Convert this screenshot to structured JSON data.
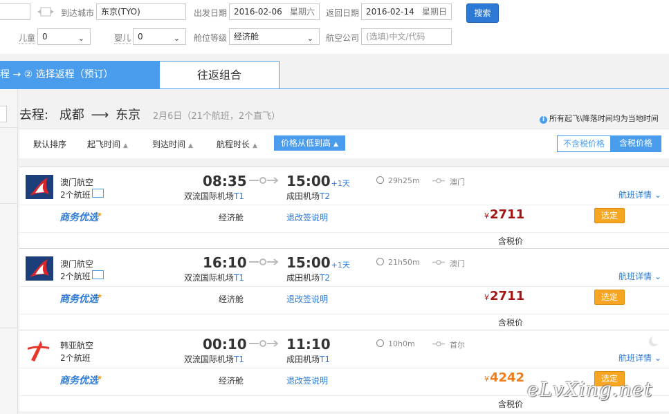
{
  "search": {
    "arrive_city_label": "到达城市",
    "arrive_city_value": "东京(TYO)",
    "depart_date_label": "出发日期",
    "depart_date_value": "2016-02-06",
    "depart_weekday": "星期六",
    "return_date_label": "返回日期",
    "return_date_value": "2016-02-14",
    "return_weekday": "星期日",
    "search_button": "搜索",
    "child_label": "儿童",
    "child_value": "0",
    "infant_label": "婴儿",
    "infant_value": "0",
    "cabin_label": "舱位等级",
    "cabin_value": "经济舱",
    "airline_label": "航空公司",
    "airline_placeholder": "(选填)中文/代码",
    "swap_icon": "swap-icon"
  },
  "steps": {
    "step_text": "程 → ② 选择返程（预订）",
    "combo_tab": "往返组合"
  },
  "route": {
    "prefix": "去程:",
    "from": "成都",
    "to": "东京",
    "summary": "2月6日（21个航班，2个直飞）",
    "local_time_note": "所有起飞\\降落时间均为当地时间"
  },
  "sort": {
    "default": "默认排序",
    "depart_time": "起飞时间",
    "arrive_time": "到达时间",
    "duration": "航程时长",
    "price_low_high": "价格从低到高",
    "excl_tax": "不含税价格",
    "incl_tax": "含税价格"
  },
  "flights": [
    {
      "airline": "澳门航空",
      "flight_count": "2个航班",
      "logo": "air-macau-logo",
      "dep_time": "08:35",
      "dep_airport": "双流国际机场",
      "dep_terminal": "T1",
      "arr_time": "15:00",
      "arr_plus": "+1天",
      "arr_airport": "成田机场",
      "arr_terminal": "T2",
      "duration": "29h25m",
      "stop_city": "澳门",
      "detail": "航班详情",
      "biz_label": "商务优选",
      "cabin": "经济舱",
      "rules": "退改签说明",
      "currency": "¥",
      "price": "2711",
      "price_color": "#a31515",
      "choose": "选定",
      "tax_note": "含税价"
    },
    {
      "airline": "澳门航空",
      "flight_count": "2个航班",
      "logo": "air-macau-logo",
      "dep_time": "16:10",
      "dep_airport": "双流国际机场",
      "dep_terminal": "T1",
      "arr_time": "15:00",
      "arr_plus": "+1天",
      "arr_airport": "成田机场",
      "arr_terminal": "T2",
      "duration": "21h50m",
      "stop_city": "澳门",
      "detail": "航班详情",
      "biz_label": "商务优选",
      "cabin": "经济舱",
      "rules": "退改签说明",
      "currency": "¥",
      "price": "2711",
      "price_color": "#a31515",
      "choose": "选定",
      "tax_note": "含税价"
    },
    {
      "airline": "韩亚航空",
      "flight_count": "2个航班",
      "logo": "asiana-logo",
      "dep_time": "00:10",
      "dep_airport": "双流国际机场",
      "dep_terminal": "T1",
      "arr_time": "11:10",
      "arr_plus": "",
      "arr_airport": "成田机场",
      "arr_terminal": "T1",
      "duration": "10h0m",
      "stop_city": "首尔",
      "detail": "航班详情",
      "biz_label": "商务优选",
      "cabin": "经济舱",
      "rules": "退改签说明",
      "currency": "¥",
      "price": "4242",
      "price_color": "#f07c1a",
      "choose": "选定",
      "tax_note": "含税价",
      "night_icon": "moon-icon"
    }
  ],
  "watermark": "eLvXing.net"
}
